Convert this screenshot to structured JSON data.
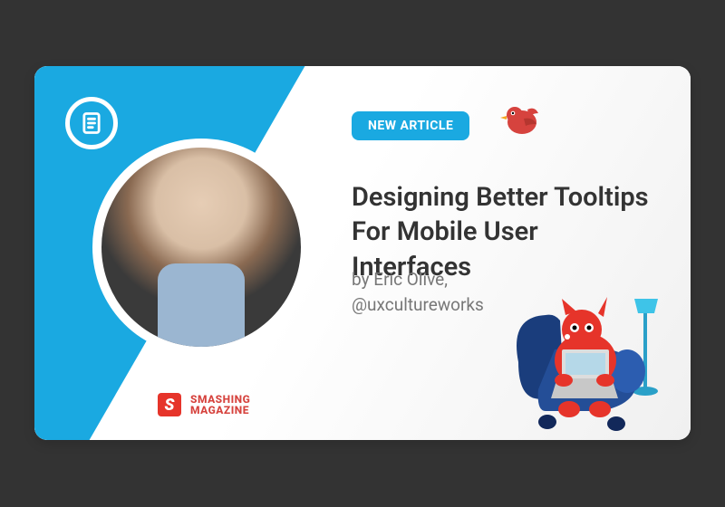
{
  "badge": {
    "label": "NEW ARTICLE"
  },
  "article": {
    "title": "Designing Better Tooltips For Mobile User Interfaces",
    "author_line": "by Eric Olive,",
    "handle": "@uxcultureworks"
  },
  "brand": {
    "line1": "SMASHING",
    "line2": "MAGAZINE"
  },
  "colors": {
    "accent": "#1aa9e1",
    "brand_red": "#e6342a",
    "cat_red": "#d6433e",
    "chair_blue": "#1a3d7c"
  },
  "icons": {
    "doc": "document-icon",
    "bird": "bird-icon",
    "cat": "cat-mascot-icon"
  }
}
